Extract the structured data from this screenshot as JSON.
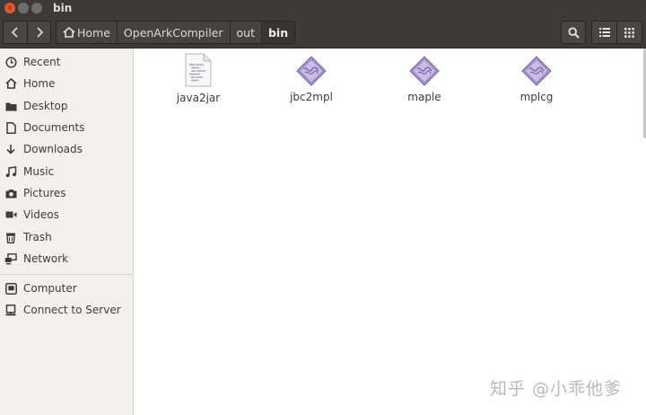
{
  "window": {
    "title": "bin",
    "controls": [
      "close-icon",
      "minimize-icon",
      "maximize-icon"
    ],
    "close_glyph": "×"
  },
  "toolbar": {
    "back_icon": "chevron-left-icon",
    "forward_icon": "chevron-right-icon",
    "breadcrumbs": [
      {
        "label": "Home",
        "icon": "home-icon"
      },
      {
        "label": "OpenArkCompiler"
      },
      {
        "label": "out"
      },
      {
        "label": "bin",
        "active": true
      }
    ],
    "search_icon": "search-icon",
    "list_view_icon": "list-view-icon",
    "grid_view_icon": "grid-view-icon"
  },
  "sidebar": {
    "items": [
      {
        "label": "Recent",
        "icon": "clock-icon"
      },
      {
        "label": "Home",
        "icon": "home-icon"
      },
      {
        "label": "Desktop",
        "icon": "folder-icon"
      },
      {
        "label": "Documents",
        "icon": "document-icon"
      },
      {
        "label": "Downloads",
        "icon": "download-icon"
      },
      {
        "label": "Music",
        "icon": "music-icon"
      },
      {
        "label": "Pictures",
        "icon": "camera-icon"
      },
      {
        "label": "Videos",
        "icon": "video-icon"
      },
      {
        "label": "Trash",
        "icon": "trash-icon"
      },
      {
        "label": "Network",
        "icon": "network-icon"
      }
    ],
    "devices": [
      {
        "label": "Computer",
        "icon": "computer-icon"
      },
      {
        "label": "Connect to Server",
        "icon": "server-icon"
      }
    ]
  },
  "files": [
    {
      "name": "java2jar",
      "icon": "text-script-icon"
    },
    {
      "name": "jbc2mpl",
      "icon": "executable-icon"
    },
    {
      "name": "maple",
      "icon": "executable-icon"
    },
    {
      "name": "mplcg",
      "icon": "executable-icon"
    }
  ],
  "watermark": "知乎 @小乖他爹",
  "colors": {
    "titlebar": "#3c3b37",
    "close_button": "#e95420",
    "sidebar": "#f2f1f0",
    "executable_icon": "#9b87c4"
  }
}
